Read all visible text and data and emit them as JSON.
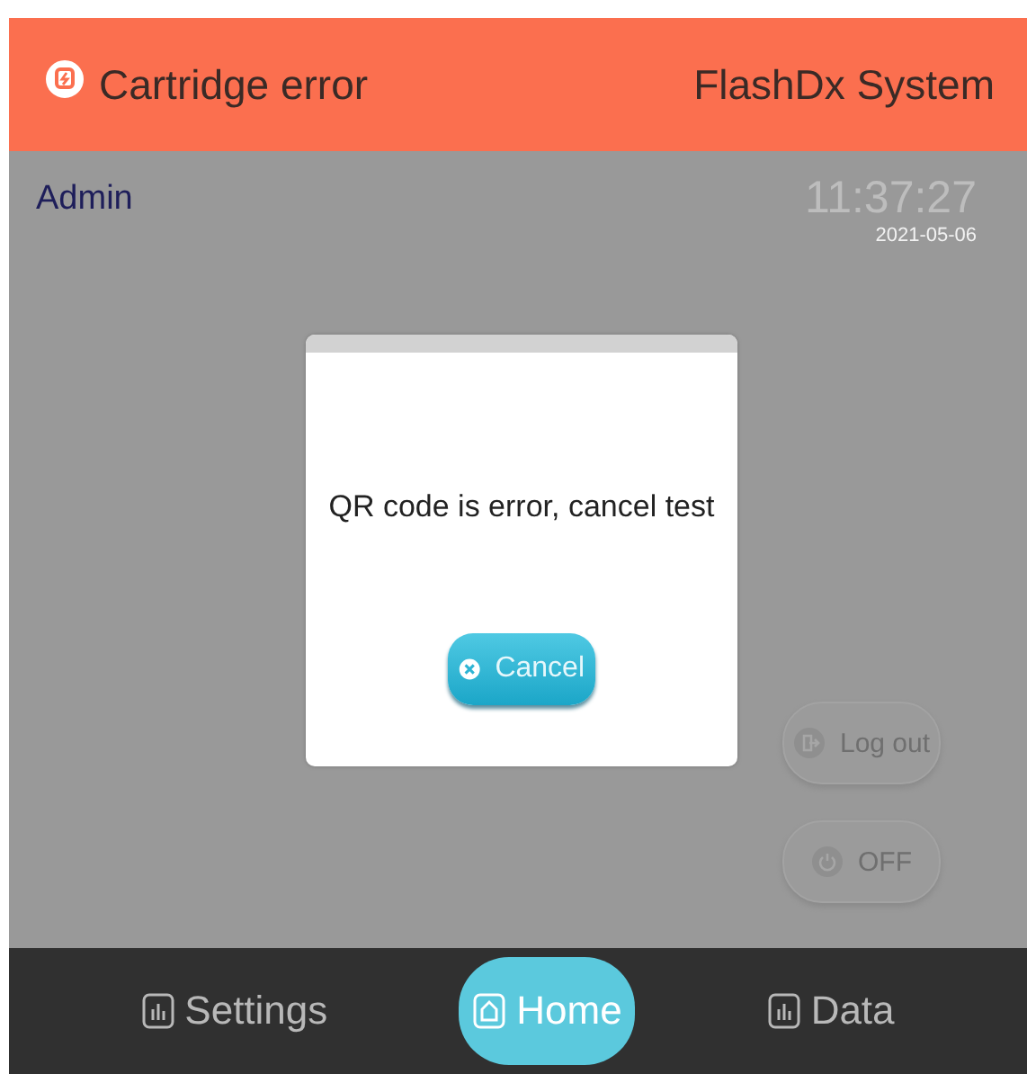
{
  "header": {
    "title": "Cartridge error",
    "system": "FlashDx System"
  },
  "user": "Admin",
  "clock": {
    "time": "11:37:27",
    "date": "2021-05-06"
  },
  "side_buttons": [
    {
      "label": "Log out",
      "kind": "logout"
    },
    {
      "label": "OFF",
      "kind": "power"
    }
  ],
  "dialog": {
    "message": "QR code is error, cancel test",
    "button": "Cancel"
  },
  "nav": [
    {
      "label": "Settings",
      "kind": "chart",
      "selected": false
    },
    {
      "label": "Home",
      "kind": "home",
      "selected": true
    },
    {
      "label": "Data",
      "kind": "chart",
      "selected": false
    }
  ]
}
